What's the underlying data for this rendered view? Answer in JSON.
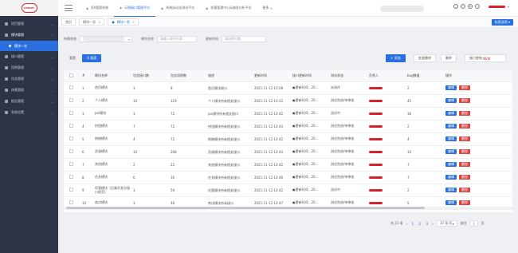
{
  "logo": {
    "text": "CHERRY"
  },
  "sidebar": {
    "items": [
      {
        "label": "项目管理"
      },
      {
        "label": "模块管理",
        "open": true,
        "sub": "模块一览"
      },
      {
        "label": "接口管理"
      },
      {
        "label": "用例管理"
      },
      {
        "label": "任务管理"
      },
      {
        "label": "场景管理"
      },
      {
        "label": "报告管理"
      },
      {
        "label": "系统设置"
      }
    ]
  },
  "header": {
    "tabs": [
      {
        "label": "QA管理系统",
        "icon": "◆"
      },
      {
        "label": "示例接口管理平台",
        "icon": "◆",
        "active": true
      },
      {
        "label": "系统自动化测试平台",
        "icon": "◆"
      },
      {
        "label": "质量管理中心&缺陷分析平台",
        "icon": "◆"
      },
      {
        "label": "更多",
        "icon": ""
      }
    ]
  },
  "tagbar": {
    "tags": [
      {
        "label": "首页"
      },
      {
        "label": "模块一览"
      },
      {
        "label": "模块一览",
        "active": true
      }
    ],
    "close_all": "标签选项 ▾"
  },
  "search": {
    "system_label": "所属系统",
    "module_label": "模块名称",
    "module_placeholder": "请输入模块名称",
    "time_label": "更新时间",
    "time_placeholder": "请选择日期"
  },
  "actions": {
    "reset": "重置",
    "query": "Q 搜索",
    "add": "+ 添加",
    "batch_delete": "批量删除",
    "delete": "删除",
    "export": "接口更新",
    "export_badge": "NEW"
  },
  "table": {
    "columns": [
      "",
      "#",
      "模块名称",
      "包含接口数",
      "包含用例数",
      "描述",
      "更新时间",
      "接口更新时间",
      "测试状态",
      "负责人",
      "bug数量",
      "操作"
    ],
    "rows": [
      [
        "1",
        "首页模块",
        "3",
        "8",
        "首页模块接口",
        "2021-11-12 15:08",
        "●更新时间：20…",
        "未测评",
        "",
        "2"
      ],
      [
        "2",
        "个人模块",
        "10",
        "119",
        "个人模块所有相关接口",
        "2021-11-12 14:32",
        "●更新时间：20…",
        "测试完成/待审核",
        "",
        "45"
      ],
      [
        "3",
        "poi模块",
        "3",
        "72",
        "poi模块所有相关接口",
        "2021-11-12 14:42",
        "●更新时间：20…",
        "测试中",
        "",
        "38"
      ],
      [
        "4",
        "拼团模块",
        "7",
        "72",
        "拼团模块所有相关接口",
        "2021-11-12 14:44",
        "●更新时间：20…",
        "测试完成/待审核",
        "",
        "2"
      ],
      [
        "5",
        "购物模块",
        "4",
        "72",
        "购物模块所有相关接口",
        "2021-11-12 14:42",
        "●更新时间：20…",
        "测试完成/待审核",
        "",
        "4"
      ],
      [
        "6",
        "资源模块",
        "10",
        "268",
        "资源模块所有相关接口",
        "2021-11-12 14:44",
        "●更新时间：20…",
        "测试完成/待审核",
        "",
        "10"
      ],
      [
        "7",
        "其他模块",
        "2",
        "22",
        "其他模块所有相关接口",
        "2021-11-12 14:42",
        "●更新时间：20…",
        "测试完成/待审核",
        "",
        "7"
      ],
      [
        "8",
        "任务模块",
        "6",
        "36",
        "任务模块所有相关接口",
        "2021-11-12 14:46",
        "●更新时间：20…",
        "测试完成/待审核",
        "",
        "7"
      ],
      [
        "9",
        "优惠模块（后端开发分接口规范）",
        "3",
        "59",
        "优惠模块所有相关接口",
        "2021-11-12 14:42",
        "●更新时间：20…",
        "测试中",
        "",
        "2"
      ],
      [
        "10",
        "商详模块",
        "3",
        "48",
        "商详模块所有接口",
        "2021-11-12 14:47",
        "●更新时间：20…",
        "测试完成/待审核",
        "",
        "5"
      ]
    ],
    "edit": "编辑",
    "del": "删除"
  },
  "pager": {
    "total": "共 21 条",
    "prev": "‹",
    "pages": [
      "1",
      "2",
      "3"
    ],
    "next": "›",
    "size": "10 条/页",
    "goto": "前往",
    "goto_page": "1",
    "page_unit": "页"
  }
}
